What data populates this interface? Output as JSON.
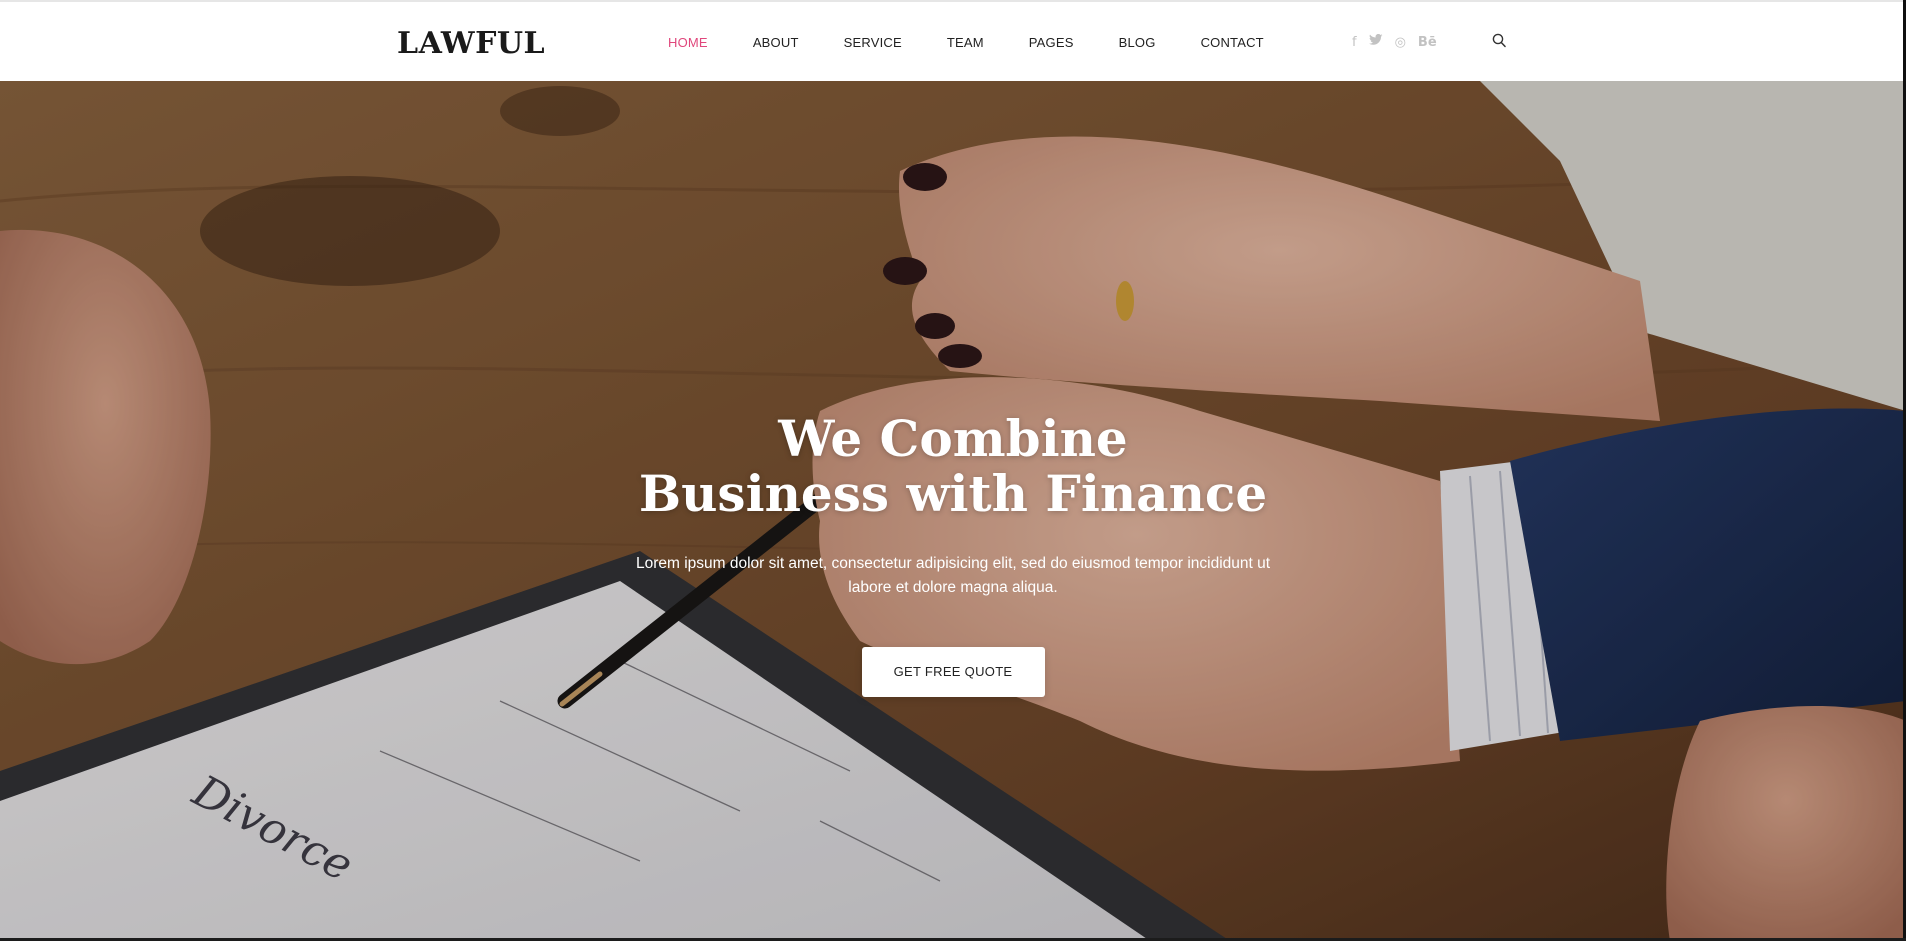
{
  "header": {
    "logo": "LAWFUL",
    "nav": [
      {
        "label": "HOME",
        "active": true
      },
      {
        "label": "ABOUT",
        "active": false
      },
      {
        "label": "SERVICE",
        "active": false
      },
      {
        "label": "TEAM",
        "active": false
      },
      {
        "label": "PAGES",
        "active": false
      },
      {
        "label": "BLOG",
        "active": false
      },
      {
        "label": "CONTACT",
        "active": false
      }
    ],
    "social": {
      "facebook": "f",
      "twitter": "t",
      "dribbble": "◎",
      "behance": "Bē"
    },
    "search_icon": "search-icon"
  },
  "hero": {
    "title_line1": "We Combine",
    "title_line2": "Business with Finance",
    "text": "Lorem ipsum dolor sit amet, consectetur adipisicing elit, sed do eiusmod tempor incididunt ut labore et dolore magna aliqua.",
    "cta_label": "GET FREE QUOTE"
  },
  "colors": {
    "accent": "#e0477c",
    "logo": "#1a1a1a",
    "nav_text": "#222222",
    "social_icon": "#c2c2c2"
  }
}
